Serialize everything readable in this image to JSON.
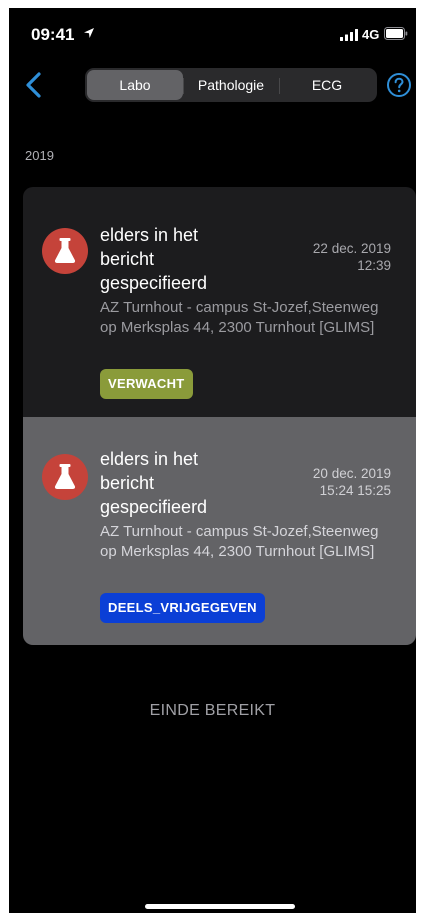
{
  "status": {
    "time": "09:41",
    "network": "4G"
  },
  "nav": {
    "tabs": [
      {
        "label": "Labo",
        "active": true
      },
      {
        "label": "Pathologie",
        "active": false
      },
      {
        "label": "ECG",
        "active": false
      }
    ]
  },
  "section": {
    "year": "2019"
  },
  "results": [
    {
      "title": "elders in het bericht gespecifieerd",
      "date_line1": "22 dec. 2019",
      "date_line2": "12:39",
      "address": "AZ Turnhout - campus St-Jozef,Steenweg op Merksplas 44, 2300 Turnhout [GLIMS]",
      "status": "VERWACHT",
      "status_color": "#8a9b3a",
      "icon": "flask-icon"
    },
    {
      "title": "elders in het bericht gespecifieerd",
      "date_line1": "20 dec. 2019",
      "date_line2": "15:24 15:25",
      "address": "AZ Turnhout - campus St-Jozef,Steenweg op Merksplas 44, 2300 Turnhout [GLIMS]",
      "status": "DEELS_VRIJGEGEVEN",
      "status_color": "#0b3fd6",
      "icon": "flask-icon"
    }
  ],
  "footer": {
    "end_text": "EINDE BEREIKT"
  },
  "colors": {
    "accent": "#2f8fd8",
    "icon_bg": "#c5433a",
    "background": "#000000"
  }
}
